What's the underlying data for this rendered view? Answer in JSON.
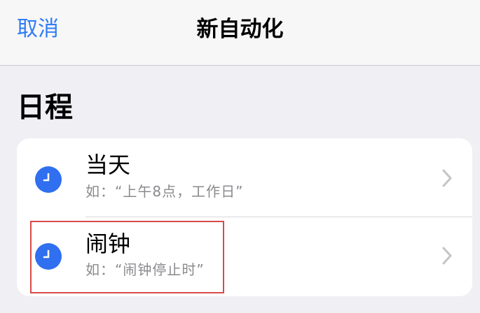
{
  "header": {
    "cancel_label": "取消",
    "title": "新自动化"
  },
  "section": {
    "title": "日程"
  },
  "options": [
    {
      "title": "当天",
      "subtitle": "如：“上午8点，工作日”",
      "icon": "clock-icon"
    },
    {
      "title": "闹钟",
      "subtitle": "如：“闹钟停止时”",
      "icon": "clock-icon"
    }
  ],
  "colors": {
    "accent": "#2f7cf6",
    "icon_bg": "#2f6ff0",
    "highlight": "#d84a4a",
    "background": "#efeff4"
  }
}
